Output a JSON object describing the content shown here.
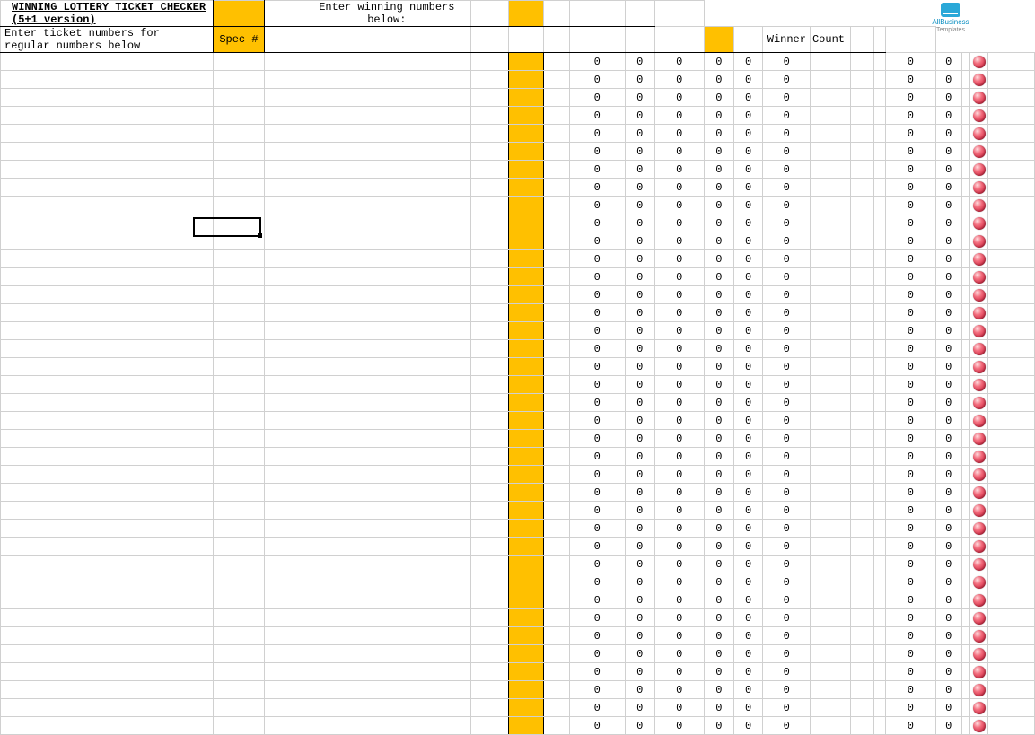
{
  "title": "WINNING LOTTERY TICKET CHECKER (5+1 version)",
  "instruction_left": "Enter ticket numbers for regular numbers below",
  "spec_header": "Spec #",
  "instruction_right": "Enter winning numbers below:",
  "winner_label": "Winner",
  "count_label": "Count",
  "logo": {
    "brand": "AllBusiness",
    "sub": "Templates"
  },
  "rows_count": 38,
  "row": {
    "r1": "0",
    "r2": "0",
    "r3": "0",
    "r4": "0",
    "r5": "0",
    "r6": "0",
    "w": "0",
    "c": "0"
  },
  "chart_data": {
    "type": "table",
    "title": "WINNING LOTTERY TICKET CHECKER (5+1 version)",
    "columns": [
      "ticket_n1",
      "ticket_n2",
      "ticket_n3",
      "ticket_n4",
      "ticket_n5",
      "spec_number",
      "result_n1",
      "result_n2",
      "result_n3",
      "result_n4",
      "result_n5",
      "result_n6",
      "winner",
      "count"
    ],
    "rows_visible": 38,
    "default_values": {
      "ticket_n1": null,
      "ticket_n2": null,
      "ticket_n3": null,
      "ticket_n4": null,
      "ticket_n5": null,
      "spec_number": null,
      "result_n1": 0,
      "result_n2": 0,
      "result_n3": 0,
      "result_n4": 0,
      "result_n5": 0,
      "result_n6": 0,
      "winner": 0,
      "count": 0
    }
  }
}
